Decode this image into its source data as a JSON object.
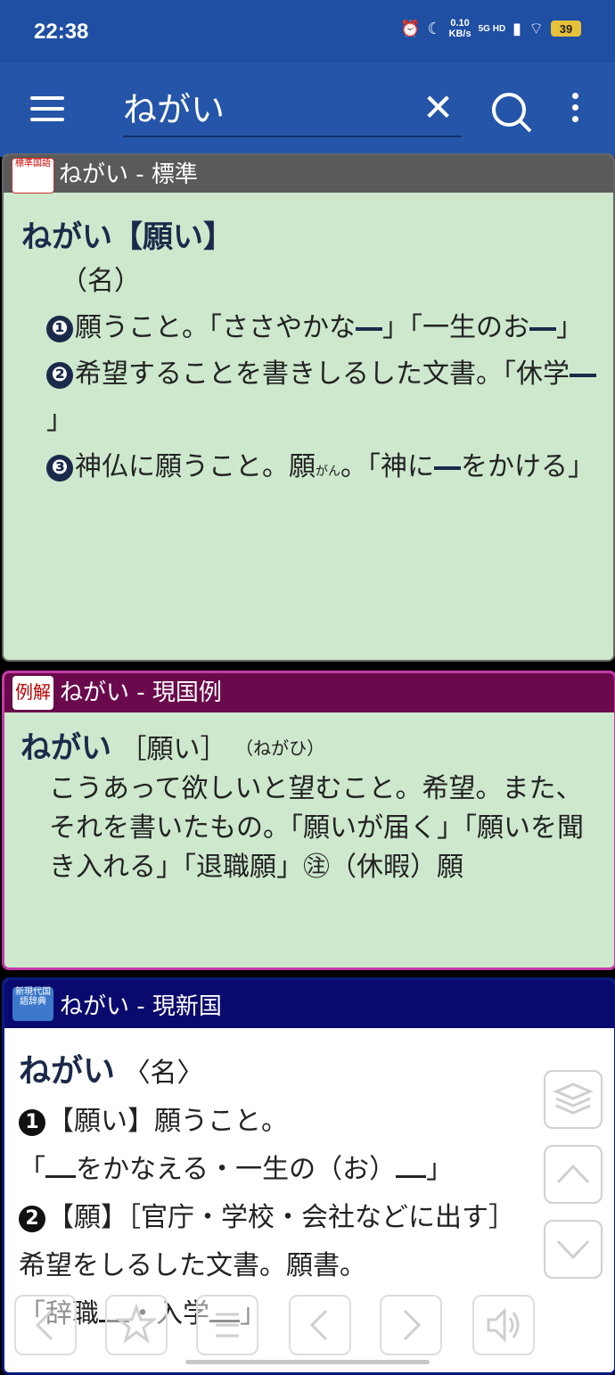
{
  "status_bar": {
    "time": "22:38",
    "speed_value": "0.10",
    "speed_unit": "KB/s",
    "network": "5G HD",
    "battery": "39"
  },
  "toolbar": {
    "query": "ねがい"
  },
  "panels": [
    {
      "title": "ねがい - 標準",
      "icon_text": "標準国語",
      "headword": "ねがい【願い】",
      "pos": "（名）",
      "senses": [
        {
          "num": "❶",
          "text_a": "願うこと。「ささやかな",
          "text_b": "」「一生のお",
          "text_c": "」"
        },
        {
          "num": "❷",
          "text_a": "希望することを書きしるした文書。「休学",
          "text_b": "」"
        },
        {
          "num": "❸",
          "text_a": "神仏に願うこと。願",
          "ruby": "がん",
          "text_b": "。「神に",
          "text_c": "をかける」"
        }
      ]
    },
    {
      "title": "ねがい - 現国例",
      "icon_text": "例解",
      "headword": "ねがい",
      "kanji": "［願い］",
      "reading": "（ねがひ）",
      "definition": "こうあって欲しいと望むこと。希望。また、それを書いたもの。「願いが届く」「願いを聞き入れる」「退職願」㊟（休暇）願"
    },
    {
      "title": "ねがい - 現新国",
      "icon_text": "新現代国語辞典",
      "headword": "ねがい",
      "pos": "〈名〉",
      "sense1_label": "【願い】願うこと。",
      "sense1_example_a": "「",
      "sense1_example_b": "をかなえる・一生の（お）",
      "sense1_example_c": "」",
      "sense2_label": "【願】［官庁・学校・会社などに出す］",
      "sense2_text": "希望をしるした文書。願書。",
      "sense2_example_a": "「辞職",
      "sense2_example_b": "・入学",
      "sense2_example_c": "」"
    }
  ]
}
